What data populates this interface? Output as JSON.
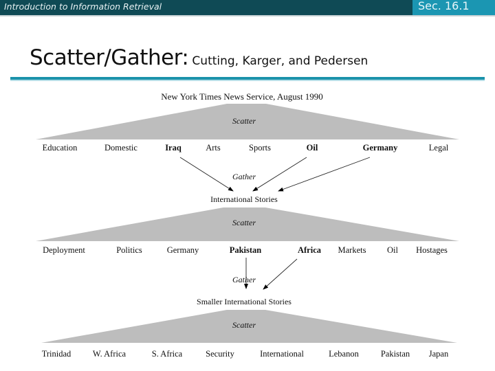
{
  "header": {
    "course_title": "Introduction to Information Retrieval",
    "section": "Sec. 16.1"
  },
  "slide": {
    "title_main": "Scatter/Gather:",
    "title_sub": "Cutting, Karger, and Pedersen"
  },
  "colors": {
    "header_dark": "#0f4a55",
    "header_accent": "#1b96b2",
    "rule": "#1b92ab",
    "trapezoid_fill": "#bdbdbd"
  },
  "diagram": {
    "source_label": "New York Times News Service, August 1990",
    "levels": [
      {
        "scatter_label": "Scatter",
        "clusters": [
          {
            "label": "Education",
            "bold": false
          },
          {
            "label": "Domestic",
            "bold": false
          },
          {
            "label": "Iraq",
            "bold": true
          },
          {
            "label": "Arts",
            "bold": false
          },
          {
            "label": "Sports",
            "bold": false
          },
          {
            "label": "Oil",
            "bold": true
          },
          {
            "label": "Germany",
            "bold": true
          },
          {
            "label": "Legal",
            "bold": false
          }
        ],
        "gather_label": "Gather",
        "gathered_into": "International Stories",
        "gathered_from": [
          "Iraq",
          "Oil",
          "Germany"
        ]
      },
      {
        "scatter_label": "Scatter",
        "clusters": [
          {
            "label": "Deployment",
            "bold": false
          },
          {
            "label": "Politics",
            "bold": false
          },
          {
            "label": "Germany",
            "bold": false
          },
          {
            "label": "Pakistan",
            "bold": true
          },
          {
            "label": "Africa",
            "bold": true
          },
          {
            "label": "Markets",
            "bold": false
          },
          {
            "label": "Oil",
            "bold": false
          },
          {
            "label": "Hostages",
            "bold": false
          }
        ],
        "gather_label": "Gather",
        "gathered_into": "Smaller International Stories",
        "gathered_from": [
          "Pakistan",
          "Africa"
        ]
      },
      {
        "scatter_label": "Scatter",
        "clusters": [
          {
            "label": "Trinidad",
            "bold": false
          },
          {
            "label": "W. Africa",
            "bold": false
          },
          {
            "label": "S. Africa",
            "bold": false
          },
          {
            "label": "Security",
            "bold": false
          },
          {
            "label": "International",
            "bold": false
          },
          {
            "label": "Lebanon",
            "bold": false
          },
          {
            "label": "Pakistan",
            "bold": false
          },
          {
            "label": "Japan",
            "bold": false
          }
        ]
      }
    ]
  }
}
